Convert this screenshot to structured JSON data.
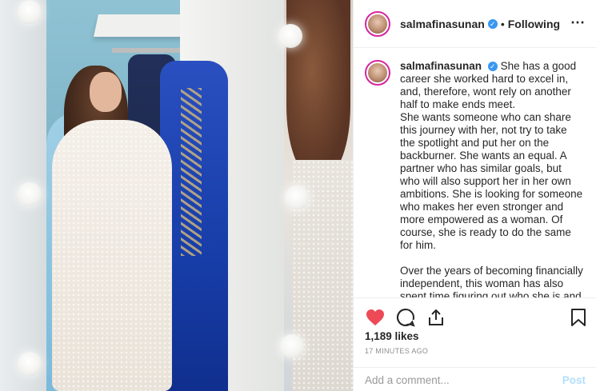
{
  "post": {
    "username": "salmafinasunan",
    "follow_status": "Following",
    "separator": "•",
    "more_icon": "⋯",
    "verified_icon": "✓"
  },
  "caption": {
    "username": "salmafinasunan",
    "paragraphs": [
      "She has a good career she worked hard to excel in, and, therefore, wont rely on another half to make ends meet.\nShe wants someone who can share this journey with her, not try to take the spotlight and put her on the backburner. She wants an equal. A partner who has similar goals, but who will also support her in her own ambitions. She is looking for someone who makes her even stronger and more empowered as a woman. Of course, she is ready to do the same for him.",
      "Over the years of becoming financially independent, this woman has also spent time figuring out who she is and what's most important to her. She has"
    ]
  },
  "actions": {
    "likes": "1,189 likes",
    "timestamp": "17 MINUTES AGO",
    "liked": true,
    "like_color": "#ed4956"
  },
  "comment": {
    "placeholder": "Add a comment...",
    "post_label": "Post",
    "post_color": "#b2dffc"
  }
}
